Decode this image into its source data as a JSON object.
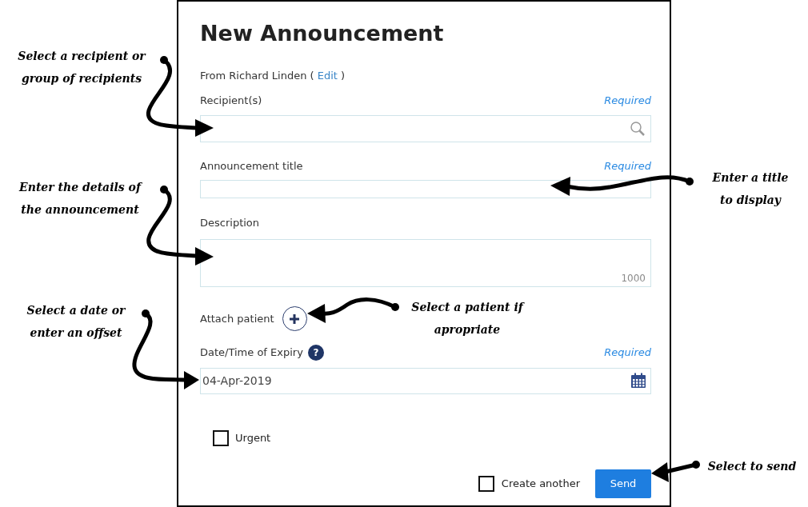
{
  "dialog": {
    "title": "New Announcement",
    "from_text": "From Richard Linden (",
    "from_link": "Edit",
    "from_after": ")"
  },
  "fields": [
    {
      "kind": "search",
      "label": "Recipient(s)",
      "required_text": "Required"
    },
    {
      "kind": "text",
      "label": "Announcement title",
      "required_text": "Required"
    },
    {
      "kind": "textarea",
      "label": "Description",
      "counter": "1000"
    }
  ],
  "attach_patient": {
    "label": "Attach patient"
  },
  "expiry": {
    "label": "Date/Time of Expiry",
    "help_icon": "?",
    "required_text": "Required",
    "value": "04-Apr-2019"
  },
  "urgent": {
    "label": "Urgent",
    "checked": false
  },
  "create_another": {
    "label": "Create another",
    "checked": false
  },
  "send_button": "Send",
  "annotations": [
    {
      "lines": [
        "Select a recipient or",
        "group of recipients"
      ]
    },
    {
      "lines": [
        "Enter the details of",
        "the announcement"
      ]
    },
    {
      "lines": [
        "Select a date or",
        "enter an offset"
      ]
    },
    {
      "lines": [
        "Enter a title",
        "to display"
      ]
    },
    {
      "lines": [
        "Select a patient if",
        "apropriate"
      ]
    },
    {
      "lines": [
        "Select to send"
      ]
    }
  ]
}
